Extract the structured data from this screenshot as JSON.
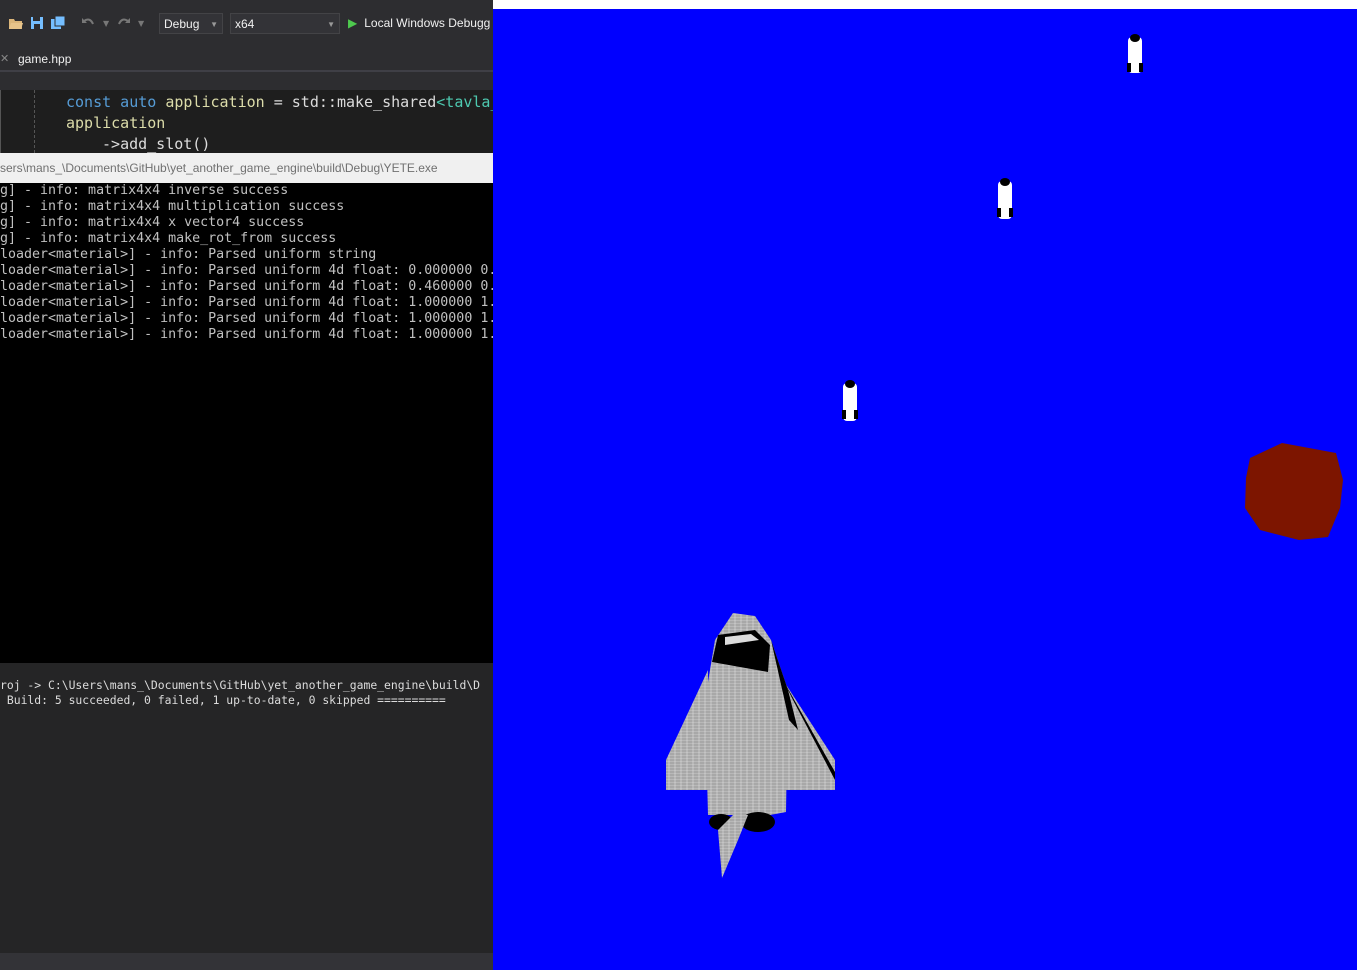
{
  "toolbar": {
    "config_select": "Debug",
    "platform_select": "x64",
    "run_label": "Local Windows Debugg"
  },
  "tabs": {
    "active_tab": "game.hpp"
  },
  "editor": {
    "lines": [
      {
        "kw": "const auto ",
        "var": "application",
        "rest": " = std::",
        "fn": "make_shared",
        "type": "<tavla_"
      },
      {
        "var": "application"
      },
      {
        "arrow": "->",
        "fn": "add_slot()"
      }
    ]
  },
  "console": {
    "title": "sers\\mans_\\Documents\\GitHub\\yet_another_game_engine\\build\\Debug\\YETE.exe",
    "lines": [
      "g] - info: matrix4x4 inverse success",
      "g] - info: matrix4x4 multiplication success",
      "g] - info: matrix4x4 x vector4 success",
      "g] - info: matrix4x4 make_rot_from success",
      "loader<material>] - info: Parsed uniform string",
      "loader<material>] - info: Parsed uniform 4d float: 0.000000 0.",
      "loader<material>] - info: Parsed uniform 4d float: 0.460000 0.",
      "loader<material>] - info: Parsed uniform 4d float: 1.000000 1.",
      "loader<material>] - info: Parsed uniform 4d float: 1.000000 1.",
      "loader<material>] - info: Parsed uniform 4d float: 1.000000 1."
    ]
  },
  "output": {
    "lines": [
      "roj -> C:\\Users\\mans_\\Documents\\GitHub\\yet_another_game_engine\\build\\D",
      " Build: 5 succeeded, 0 failed, 1 up-to-date, 0 skipped =========="
    ]
  },
  "game": {
    "background_color": "#0000ff",
    "asteroid_color": "#7d1500",
    "objects": [
      "missile",
      "missile",
      "missile",
      "asteroid",
      "space-shuttle"
    ]
  }
}
